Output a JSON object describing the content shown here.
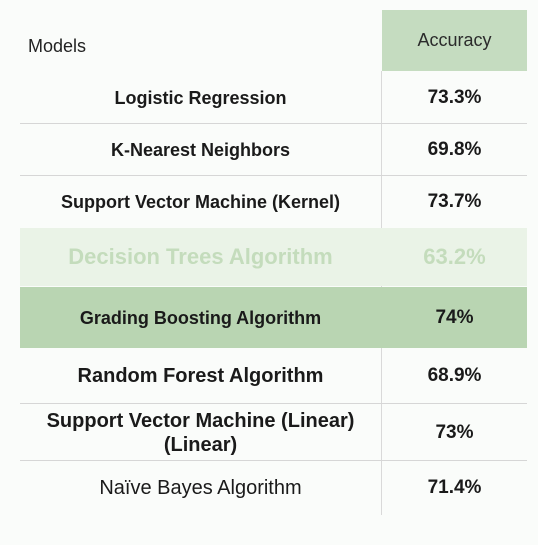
{
  "chart_data": {
    "type": "table",
    "columns": [
      "Models",
      "Accuracy"
    ],
    "rows": [
      {
        "model": "Logistic Regression",
        "accuracy": "73.3%"
      },
      {
        "model": "K-Nearest Neighbors",
        "accuracy": "69.8%"
      },
      {
        "model": "Support Vector Machine (Kernel)",
        "accuracy": "73.7%"
      },
      {
        "model": "Decision Trees Algorithm",
        "accuracy": "63.2%"
      },
      {
        "model": "Grading Boosting Algorithm",
        "accuracy": "74%"
      },
      {
        "model": "Random Forest Algorithm",
        "accuracy": "68.9%"
      },
      {
        "model": "Support Vector Machine (Linear) (Linear)",
        "accuracy": "73%"
      },
      {
        "model": "Naïve Bayes Algorithm",
        "accuracy": "71.4%"
      }
    ]
  },
  "colors": {
    "header_bg": "#c5dcc0",
    "highlight_bg": "#b9d5b2",
    "faded_bg": "#eaf3e7",
    "faded_text": "#c4dcbc"
  }
}
